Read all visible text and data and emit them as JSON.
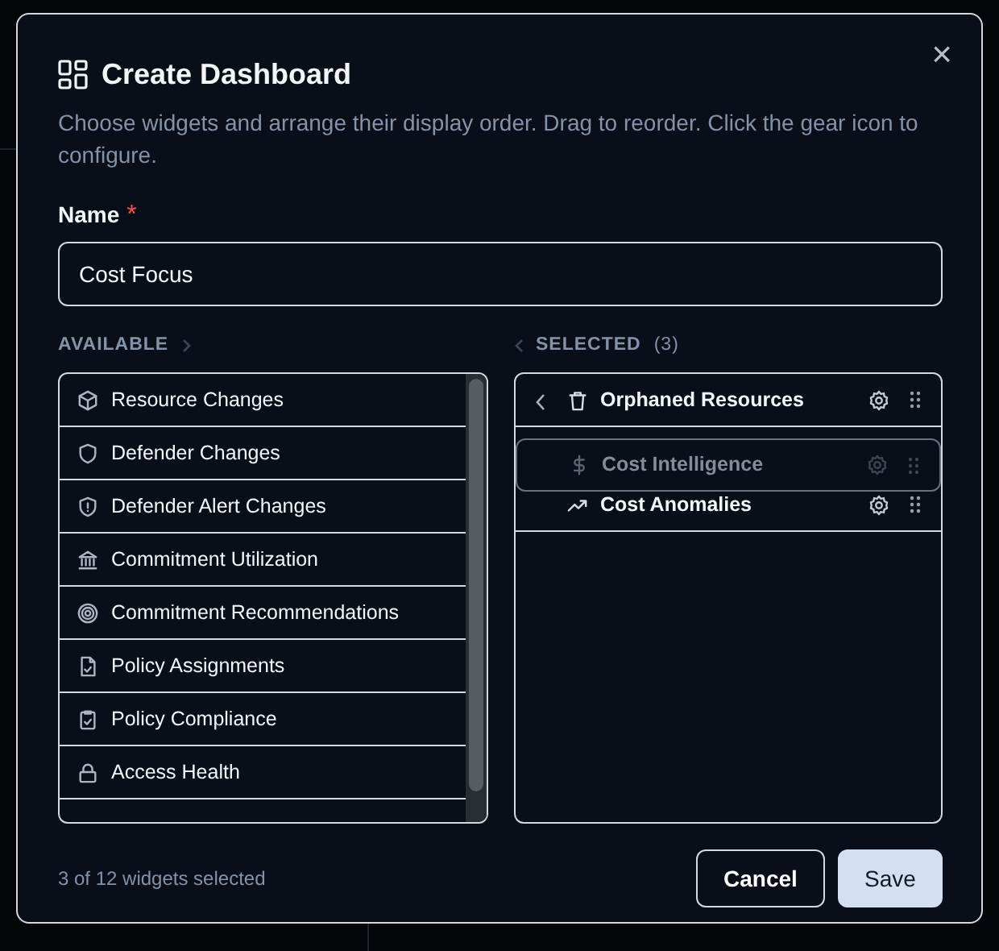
{
  "dialog": {
    "title": "Create Dashboard",
    "description": "Choose widgets and arrange their display order. Drag to reorder. Click the gear icon to configure.",
    "close": "×"
  },
  "name_field": {
    "label": "Name",
    "required_mark": "*",
    "value": "Cost Focus"
  },
  "available": {
    "heading": "AVAILABLE",
    "items": [
      {
        "label": "Resource Changes"
      },
      {
        "label": "Defender Changes"
      },
      {
        "label": "Defender Alert Changes"
      },
      {
        "label": "Commitment Utilization"
      },
      {
        "label": "Commitment Recommendations"
      },
      {
        "label": "Policy Assignments"
      },
      {
        "label": "Policy Compliance"
      },
      {
        "label": "Access Health"
      }
    ]
  },
  "selected": {
    "heading": "SELECTED",
    "count": "(3)",
    "items": [
      {
        "label": "Orphaned Resources",
        "hovered": true,
        "dragging": false
      },
      {
        "label": "Cost Intelligence",
        "hovered": false,
        "dragging": true
      },
      {
        "label": "Cost Anomalies",
        "hovered": false,
        "dragging": false
      }
    ]
  },
  "footer": {
    "summary": "3 of 12 widgets selected",
    "buttons": [
      {
        "label": "Cancel",
        "kind": "secondary"
      },
      {
        "label": "Save",
        "kind": "primary"
      }
    ]
  }
}
